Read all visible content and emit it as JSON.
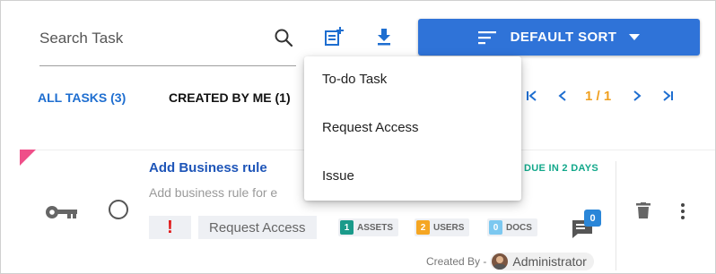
{
  "search": {
    "placeholder": "Search Task"
  },
  "toolbar": {
    "add_icon": "add-task-icon",
    "download_icon": "download-icon",
    "sort_label": "DEFAULT SORT",
    "accent": "#2f73d8"
  },
  "tabs": [
    {
      "label": "ALL TASKS (3)",
      "active": true
    },
    {
      "label": "CREATED BY ME (1)",
      "active": false
    }
  ],
  "pager": {
    "first": "|<",
    "prev": "<",
    "page_text": "1 / 1",
    "next": ">",
    "last": ">|"
  },
  "menu": {
    "items": [
      "To-do Task",
      "Request Access",
      "Issue"
    ]
  },
  "task": {
    "title": "Add Business rule",
    "description": "Add business rule for e",
    "due": "DUE IN 2 DAYS",
    "priority": "!",
    "type": "Request Access",
    "counts": [
      {
        "value": "1",
        "label": "ASSETS",
        "color": "#1a9a8a"
      },
      {
        "value": "2",
        "label": "USERS",
        "color": "#f5a623"
      },
      {
        "value": "0",
        "label": "DOCS",
        "color": "#7cc8f0"
      }
    ],
    "comments": "0",
    "created_by_label": "Created By -",
    "created_by": "Administrator"
  }
}
